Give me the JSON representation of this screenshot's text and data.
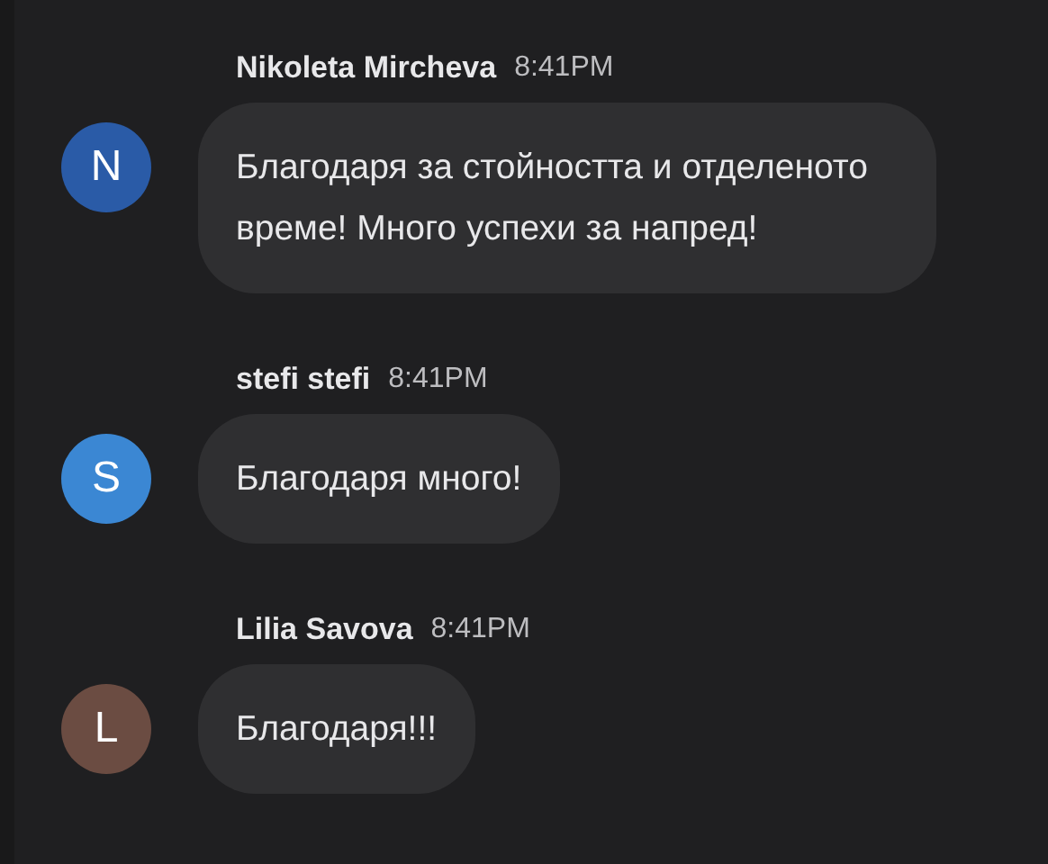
{
  "messages": [
    {
      "sender": "Nikoleta Mircheva",
      "time": "8:41PM",
      "initial": "N",
      "color": "#2a5ba7",
      "text": "Благодаря за стойността и отделеното време! Много успехи за напред!"
    },
    {
      "sender": "stefi stefi",
      "time": "8:41PM",
      "initial": "S",
      "color": "#3b87d3",
      "text": "Благодаря много!"
    },
    {
      "sender": "Lilia Savova",
      "time": "8:41PM",
      "initial": "L",
      "color": "#6b4c42",
      "text": "Благодаря!!!"
    }
  ]
}
